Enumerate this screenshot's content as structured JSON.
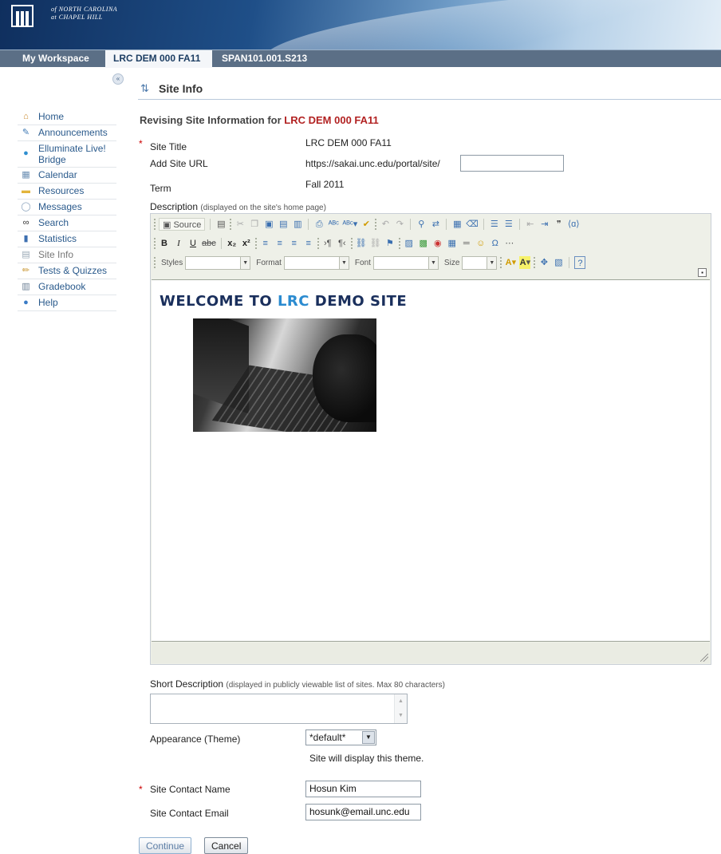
{
  "banner": {
    "logo_line1": "of NORTH CAROLINA",
    "logo_line2": "at CHAPEL HILL"
  },
  "tabs": [
    {
      "label": "My Workspace"
    },
    {
      "label": "LRC DEM 000 FA11"
    },
    {
      "label": "SPAN101.001.S213"
    }
  ],
  "collapse_glyph": "«",
  "toolmenu": [
    {
      "label": "Home",
      "icon": "home-icon"
    },
    {
      "label": "Announcements",
      "icon": "announcements-icon"
    },
    {
      "label": "Elluminate Live! Bridge",
      "icon": "elluminate-icon"
    },
    {
      "label": "Calendar",
      "icon": "calendar-icon"
    },
    {
      "label": "Resources",
      "icon": "folder-icon"
    },
    {
      "label": "Messages",
      "icon": "messages-icon"
    },
    {
      "label": "Search",
      "icon": "binoculars-icon"
    },
    {
      "label": "Statistics",
      "icon": "statistics-icon"
    },
    {
      "label": "Site Info",
      "icon": "site-info-icon"
    },
    {
      "label": "Tests & Quizzes",
      "icon": "pencil-icon"
    },
    {
      "label": "Gradebook",
      "icon": "gradebook-icon"
    },
    {
      "label": "Help",
      "icon": "help-icon"
    }
  ],
  "page": {
    "title": "Site Info",
    "revising_prefix": "Revising Site Information for ",
    "revising_site": "LRC DEM 000 FA11"
  },
  "form": {
    "required_mark": "*",
    "site_title_label": "Site Title",
    "site_title_value": "LRC DEM 000 FA11",
    "site_url_label": "Add Site URL",
    "site_url_prefix": "https://sakai.unc.edu/portal/site/",
    "site_url_value": "",
    "term_label": "Term",
    "term_value": "Fall 2011",
    "description_label": "Description",
    "description_note": "(displayed on the site's home page)",
    "short_desc_label": "Short Description",
    "short_desc_note": "(displayed in publicly viewable list of sites. Max 80 characters)",
    "short_desc_value": "",
    "theme_label": "Appearance (Theme)",
    "theme_value": "*default*",
    "theme_note": "Site will display this theme.",
    "contact_name_label": "Site Contact Name",
    "contact_name_value": "Hosun Kim",
    "contact_email_label": "Site Contact Email",
    "contact_email_value": "hosunk@email.unc.edu"
  },
  "editor": {
    "source_label": "Source",
    "combos": [
      {
        "label": "Styles"
      },
      {
        "label": "Format"
      },
      {
        "label": "Font"
      },
      {
        "label": "Size"
      }
    ],
    "content_heading_pre": "WELCOME TO ",
    "content_heading_hl": "LRC",
    "content_heading_post": " DEMO SITE"
  },
  "buttons": {
    "continue": "Continue",
    "cancel": "Cancel"
  },
  "colors": {
    "accent_red": "#b22222",
    "banner_navy": "#0f2f5e",
    "tab_bar": "#5b6f86",
    "link_blue": "#2a5a8c"
  }
}
